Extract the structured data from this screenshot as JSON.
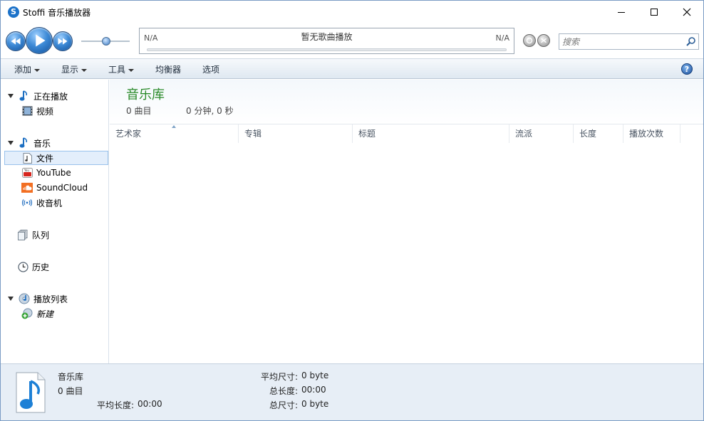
{
  "window": {
    "title": "Stoffi 音乐播放器",
    "buttons": {
      "minimize": "minimize-icon",
      "maximize": "maximize-icon",
      "close": "close-icon"
    }
  },
  "player": {
    "position_left": "N/A",
    "position_right": "N/A",
    "now_playing": "暂无歌曲播放",
    "search_placeholder": "搜索",
    "progress": 0,
    "volume": 0.5
  },
  "menu": {
    "items": [
      {
        "label": "添加",
        "has_dropdown": true
      },
      {
        "label": "显示",
        "has_dropdown": true
      },
      {
        "label": "工具",
        "has_dropdown": true
      },
      {
        "label": "均衡器",
        "has_dropdown": false
      },
      {
        "label": "选项",
        "has_dropdown": false
      }
    ],
    "help_glyph": "?"
  },
  "sidebar": {
    "now_playing": "正在播放",
    "video": "视频",
    "music": "音乐",
    "files": "文件",
    "youtube": "YouTube",
    "soundcloud": "SoundCloud",
    "radio": "收音机",
    "queue": "队列",
    "history": "历史",
    "playlists": "播放列表",
    "new_playlist": "新建",
    "selected": "files"
  },
  "library": {
    "title": "音乐库",
    "track_count": "0 曲目",
    "total_duration": "0 分钟, 0 秒",
    "columns": [
      "艺术家",
      "专辑",
      "标题",
      "流派",
      "长度",
      "播放次数"
    ],
    "rows": []
  },
  "status": {
    "title": "音乐库",
    "tracks": "0 曲目",
    "avg_length_label": "平均长度:",
    "avg_length_value": "00:00",
    "avg_size_label": "平均尺寸:",
    "avg_size_value": "0 byte",
    "total_length_label": "总长度:",
    "total_length_value": "00:00",
    "total_size_label": "总尺寸:",
    "total_size_value": "0 byte"
  },
  "colors": {
    "accent": "#2a8a2a",
    "selection": "#e3eefb",
    "menubar": "#dfe8f1",
    "statusbar": "#e7eef6"
  }
}
